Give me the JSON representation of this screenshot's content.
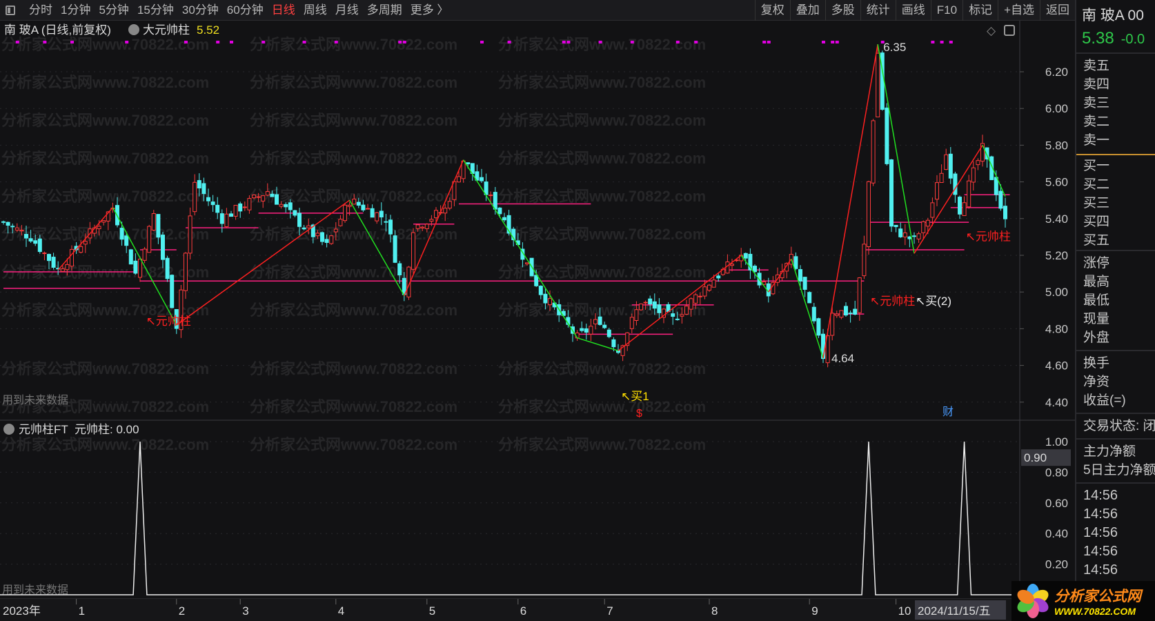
{
  "toolbar": {
    "periods": [
      "分时",
      "1分钟",
      "5分钟",
      "15分钟",
      "30分钟",
      "60分钟",
      "日线",
      "周线",
      "月线",
      "多周期",
      "更多 〉"
    ],
    "active_period": "日线",
    "actions": [
      "复权",
      "叠加",
      "多股",
      "统计",
      "画线",
      "F10",
      "标记",
      "+自选",
      "返回"
    ]
  },
  "main_chart": {
    "title": "南 玻A (日线,前复权)",
    "indicator_name": "大元帅柱",
    "indicator_value": "5.52",
    "future_data_note": "用到未来数据",
    "watermark": "分析家公式网www.70822.com"
  },
  "sub_chart": {
    "title": "元帅柱FT",
    "indicator_label": "元帅柱: 0.00",
    "future_data_note": "用到未来数据",
    "cursor_value": "0.90"
  },
  "time_axis": {
    "year_label": "2023年",
    "months": [
      "1",
      "2",
      "3",
      "4",
      "5",
      "6",
      "7",
      "8",
      "9",
      "10"
    ],
    "current_date": "2024/11/15/五"
  },
  "chart_data": {
    "type": "candlestick",
    "price_axis": {
      "ticks": [
        "6.20",
        "6.00",
        "5.80",
        "5.60",
        "5.40",
        "5.20",
        "5.00",
        "4.80",
        "4.60",
        "4.40"
      ],
      "range": [
        4.4,
        6.2
      ]
    },
    "sub_axis": {
      "ticks": [
        "1.00",
        "0.80",
        "0.60",
        "0.40",
        "0.20"
      ],
      "range": [
        0,
        1
      ]
    },
    "month_start_days": [
      16,
      38,
      52,
      73,
      93,
      113,
      132,
      155,
      177,
      196
    ],
    "total_days": 221,
    "price_path": [
      [
        0,
        5.38
      ],
      [
        6,
        5.3
      ],
      [
        12,
        5.12
      ],
      [
        24,
        5.46
      ],
      [
        29,
        5.1
      ],
      [
        33,
        5.42
      ],
      [
        38,
        4.82
      ],
      [
        42,
        5.6
      ],
      [
        48,
        5.4
      ],
      [
        58,
        5.55
      ],
      [
        64,
        5.4
      ],
      [
        71,
        5.25
      ],
      [
        76,
        5.5
      ],
      [
        84,
        5.4
      ],
      [
        88,
        4.98
      ],
      [
        90,
        5.35
      ],
      [
        97,
        5.45
      ],
      [
        101,
        5.72
      ],
      [
        110,
        5.4
      ],
      [
        118,
        5.0
      ],
      [
        126,
        4.75
      ],
      [
        131,
        4.85
      ],
      [
        135,
        4.68
      ],
      [
        140,
        4.95
      ],
      [
        147,
        4.85
      ],
      [
        155,
        5.05
      ],
      [
        162,
        5.2
      ],
      [
        168,
        5.0
      ],
      [
        173,
        5.18
      ],
      [
        176,
        5.0
      ],
      [
        180,
        4.65
      ],
      [
        182,
        4.9
      ],
      [
        187,
        4.88
      ],
      [
        189,
        5.25
      ],
      [
        192,
        6.3
      ],
      [
        194,
        5.7
      ],
      [
        195,
        5.35
      ],
      [
        200,
        5.28
      ],
      [
        203,
        5.4
      ],
      [
        207,
        5.75
      ],
      [
        210,
        5.45
      ],
      [
        215,
        5.78
      ],
      [
        218,
        5.55
      ],
      [
        220,
        5.38
      ]
    ],
    "zigzag": [
      [
        12,
        5.12
      ],
      [
        24,
        5.46
      ],
      [
        38,
        4.82
      ],
      [
        76,
        5.5
      ],
      [
        88,
        4.98
      ],
      [
        101,
        5.72
      ],
      [
        126,
        4.75
      ],
      [
        135,
        4.68
      ],
      [
        162,
        5.2
      ],
      [
        168,
        5.0
      ],
      [
        173,
        5.18
      ],
      [
        180,
        4.64
      ],
      [
        192,
        6.35
      ],
      [
        200,
        5.21
      ],
      [
        215,
        5.8
      ],
      [
        220,
        5.52
      ]
    ],
    "support_lines": [
      [
        5.11,
        0,
        29
      ],
      [
        5.02,
        0,
        30
      ],
      [
        5.06,
        30,
        189
      ],
      [
        5.23,
        30,
        38
      ],
      [
        5.35,
        40,
        56
      ],
      [
        5.43,
        56,
        79
      ],
      [
        5.37,
        90,
        99
      ],
      [
        5.48,
        100,
        129
      ],
      [
        4.77,
        126,
        147
      ],
      [
        4.93,
        138,
        156
      ],
      [
        5.12,
        158,
        168
      ],
      [
        4.88,
        182,
        189
      ],
      [
        5.23,
        189,
        211
      ],
      [
        5.38,
        190,
        212
      ],
      [
        5.46,
        208,
        220
      ],
      [
        5.53,
        211,
        221
      ]
    ],
    "signal_dots_days": [
      3,
      9,
      15,
      27,
      40,
      47,
      50,
      57,
      66,
      73,
      87,
      88,
      105,
      111,
      123,
      124,
      131,
      138,
      148,
      152,
      167,
      168,
      180,
      182,
      183,
      193,
      204,
      206,
      208
    ],
    "sub_spikes": [
      {
        "day": 30,
        "value": 1.0
      },
      {
        "day": 190,
        "value": 1.0
      },
      {
        "day": 211,
        "value": 1.0
      }
    ],
    "annotations": {
      "high_label": "6.35",
      "low_label": "4.64",
      "signal_labels": [
        "↖元帅柱",
        "↖元帅柱",
        "↖元帅柱"
      ],
      "buy2_label": "↖买(2)",
      "buy1_label": "↖买1",
      "dollar_label": "$",
      "finance_label": "财"
    }
  },
  "right_panel": {
    "stock_name": "南 玻A 00",
    "price": "5.38",
    "change": "-0.0",
    "asks": [
      "卖五",
      "卖四",
      "卖三",
      "卖二",
      "卖一"
    ],
    "bids": [
      "买一",
      "买二",
      "买三",
      "买四",
      "买五"
    ],
    "stats": [
      "涨停",
      "最高",
      "最低",
      "现量",
      "外盘"
    ],
    "stats2": [
      "换手",
      "净资",
      "收益(=)"
    ],
    "trade_status": "交易状态: 闭",
    "fund_flow": [
      "主力净额",
      "5日主力净额"
    ],
    "ticks": [
      "14:56",
      "14:56",
      "14:56",
      "14:56",
      "14:56",
      "14:56"
    ]
  },
  "logo": {
    "name": "分析家公式网",
    "url_text": "WWW.70822.COM"
  },
  "colors": {
    "up": "#ff3c3c",
    "down": "#50f0f0",
    "zig_up": "#ff2020",
    "zig_down": "#20e020",
    "support": "#ff2080",
    "dots": "#e000e0",
    "signal": "#ff2020",
    "buy1": "#ffe000",
    "axis_text": "#c8c8c8"
  }
}
